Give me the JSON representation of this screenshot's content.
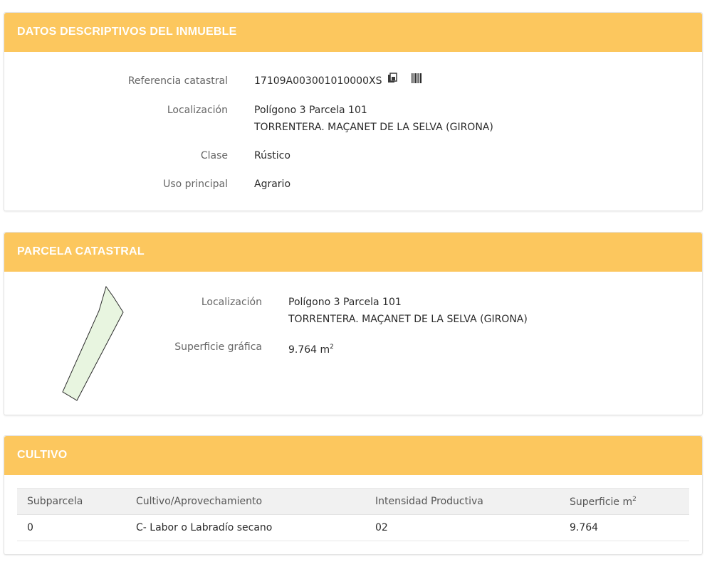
{
  "descriptive": {
    "title": "DATOS DESCRIPTIVOS DEL INMUEBLE",
    "reference_label": "Referencia catastral",
    "reference_value": "17109A003001010000XS",
    "location_label": "Localización",
    "location_line1": "Polígono 3 Parcela 101",
    "location_line2": "TORRENTERA. MAÇANET DE LA SELVA (GIRONA)",
    "class_label": "Clase",
    "class_value": "Rústico",
    "use_label": "Uso principal",
    "use_value": "Agrario",
    "icons": [
      "copy-icon",
      "barcode-icon"
    ]
  },
  "parcel": {
    "title": "PARCELA CATASTRAL",
    "location_label": "Localización",
    "location_line1": "Polígono 3 Parcela 101",
    "location_line2": "TORRENTERA. MAÇANET DE LA SELVA (GIRONA)",
    "surface_label": "Superficie gráfica",
    "surface_value": "9.764 m",
    "surface_unit_sup": "2",
    "shape_fill": "#e8f5e0"
  },
  "crops": {
    "title": "CULTIVO",
    "headers": {
      "subparcel": "Subparcela",
      "crop": "Cultivo/Aprovechamiento",
      "intensity": "Intensidad Productiva",
      "surface": "Superficie m",
      "surface_sup": "2"
    },
    "rows": [
      {
        "subparcel": "0",
        "crop": "C- Labor o Labradío secano",
        "intensity": "02",
        "surface": "9.764"
      }
    ]
  },
  "colors": {
    "header_bg": "#fcc75e",
    "header_text": "#ffffff"
  }
}
